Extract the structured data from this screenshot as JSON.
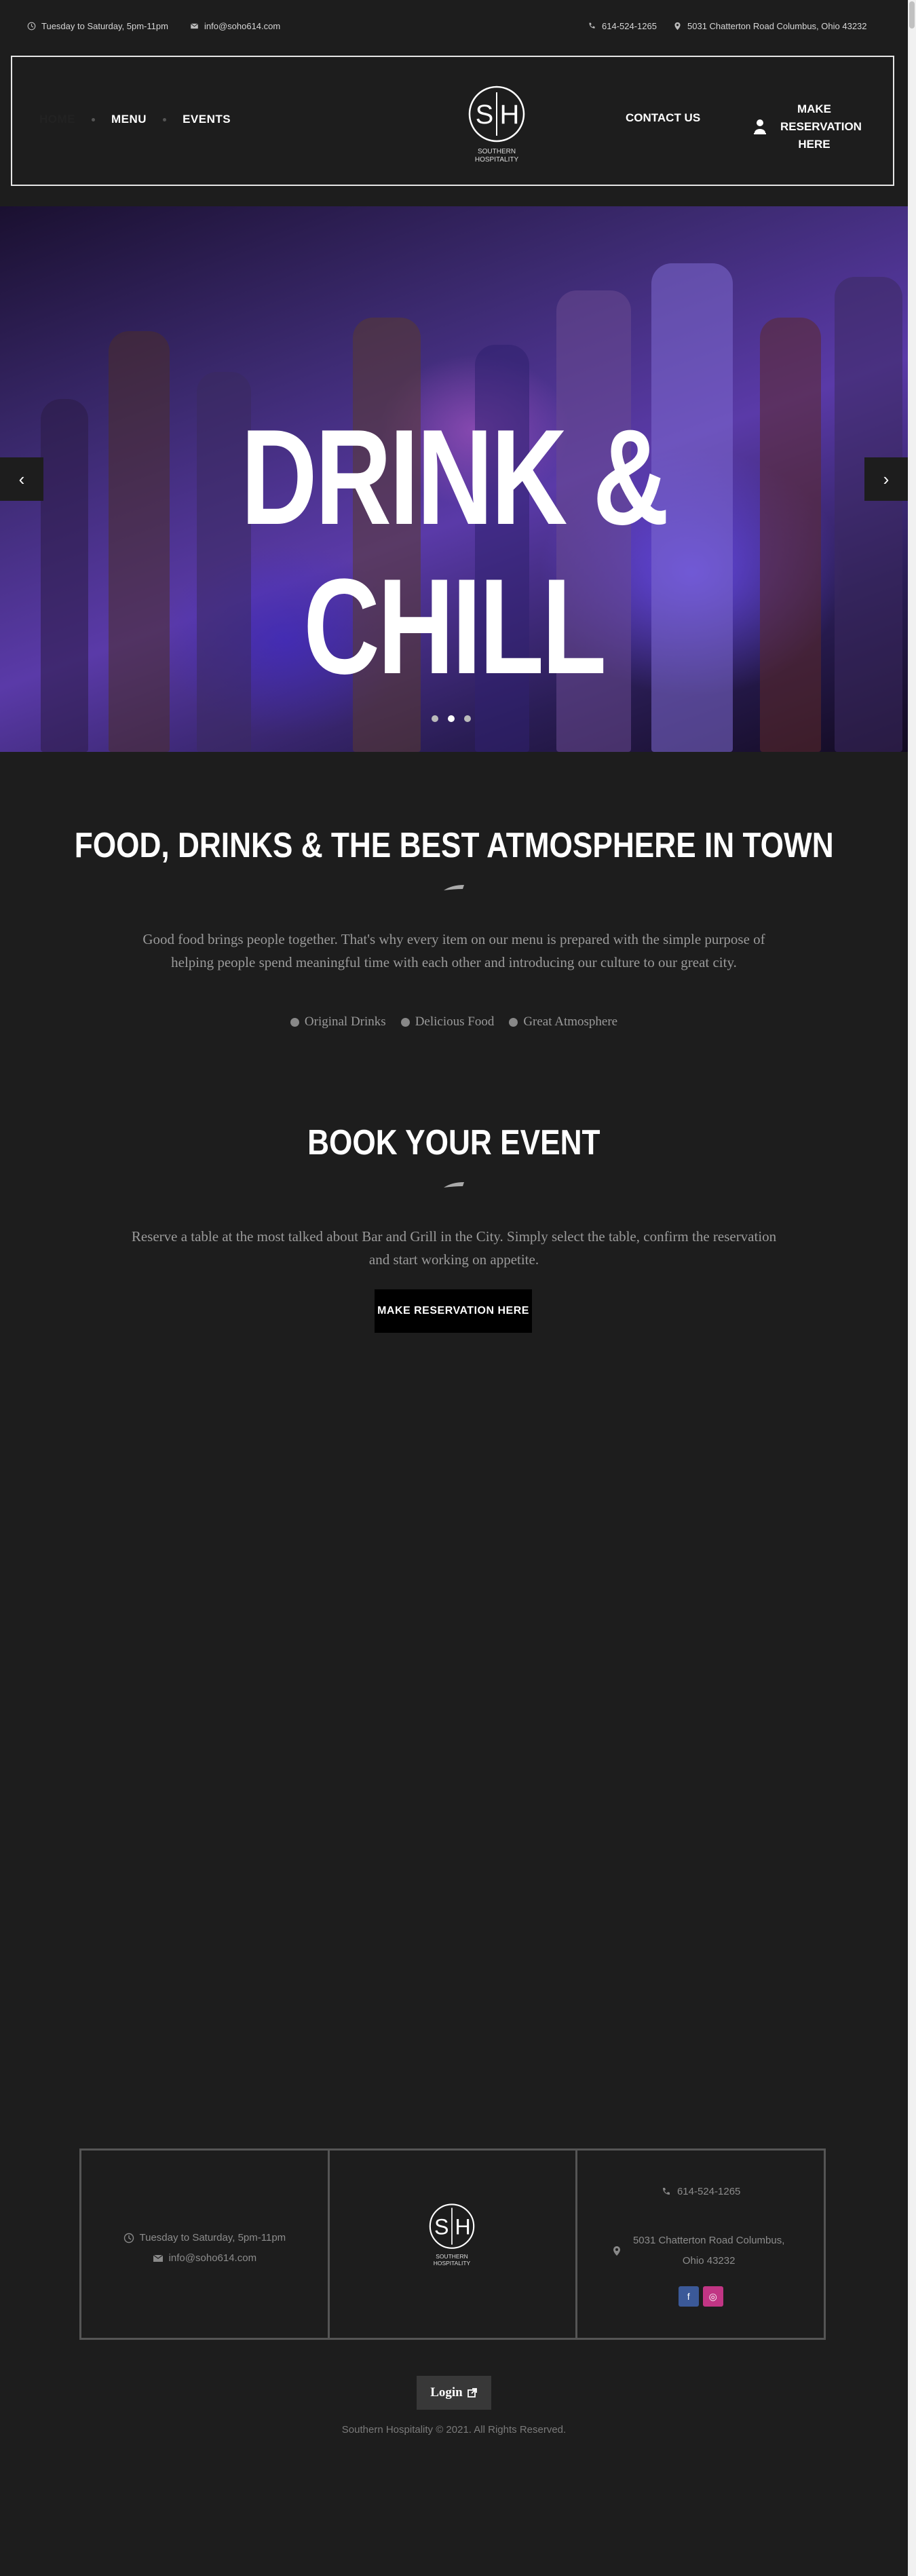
{
  "topbar": {
    "hours": "Tuesday to Saturday, 5pm-11pm",
    "email": "info@soho614.com",
    "phone": "614-524-1265",
    "address": "5031 Chatterton Road Columbus, Ohio 43232"
  },
  "nav": {
    "home": "HOME",
    "menu": "MENU",
    "events": "EVENTS",
    "contact": "CONTACT US",
    "reserve": "MAKE RESERVATION HERE"
  },
  "logo": {
    "monogram": "SH",
    "line1": "SOUTHERN",
    "line2": "HOSPITALITY"
  },
  "hero": {
    "headline": "DRINK & CHILL",
    "prev": "‹",
    "next": "›",
    "slides": 3,
    "active_slide": 1
  },
  "about": {
    "title": "FOOD, DRINKS & THE BEST ATMOSPHERE IN TOWN",
    "text": "Good food brings people together. That's why every item on our menu is prepared with the simple purpose of helping people spend meaningful time with each other and introducing our culture to our great city.",
    "features": [
      "Original Drinks",
      "Delicious Food",
      "Great Atmosphere"
    ]
  },
  "book": {
    "title": "BOOK YOUR EVENT",
    "text": "Reserve a table at the most talked about Bar and Grill in the City. Simply select the table, confirm the reservation and start working on appetite.",
    "button": "MAKE RESERVATION HERE"
  },
  "footer": {
    "hours": "Tuesday to Saturday, 5pm-11pm",
    "email": "info@soho614.com",
    "phone": "614-524-1265",
    "address": "5031 Chatterton Road Columbus, Ohio 43232",
    "login": "Login",
    "copyright": "Southern Hospitality © 2021. All Rights Reserved."
  },
  "colors": {
    "background": "#1d1d1d",
    "facebook": "#3b5998",
    "instagram": "#c13584"
  }
}
